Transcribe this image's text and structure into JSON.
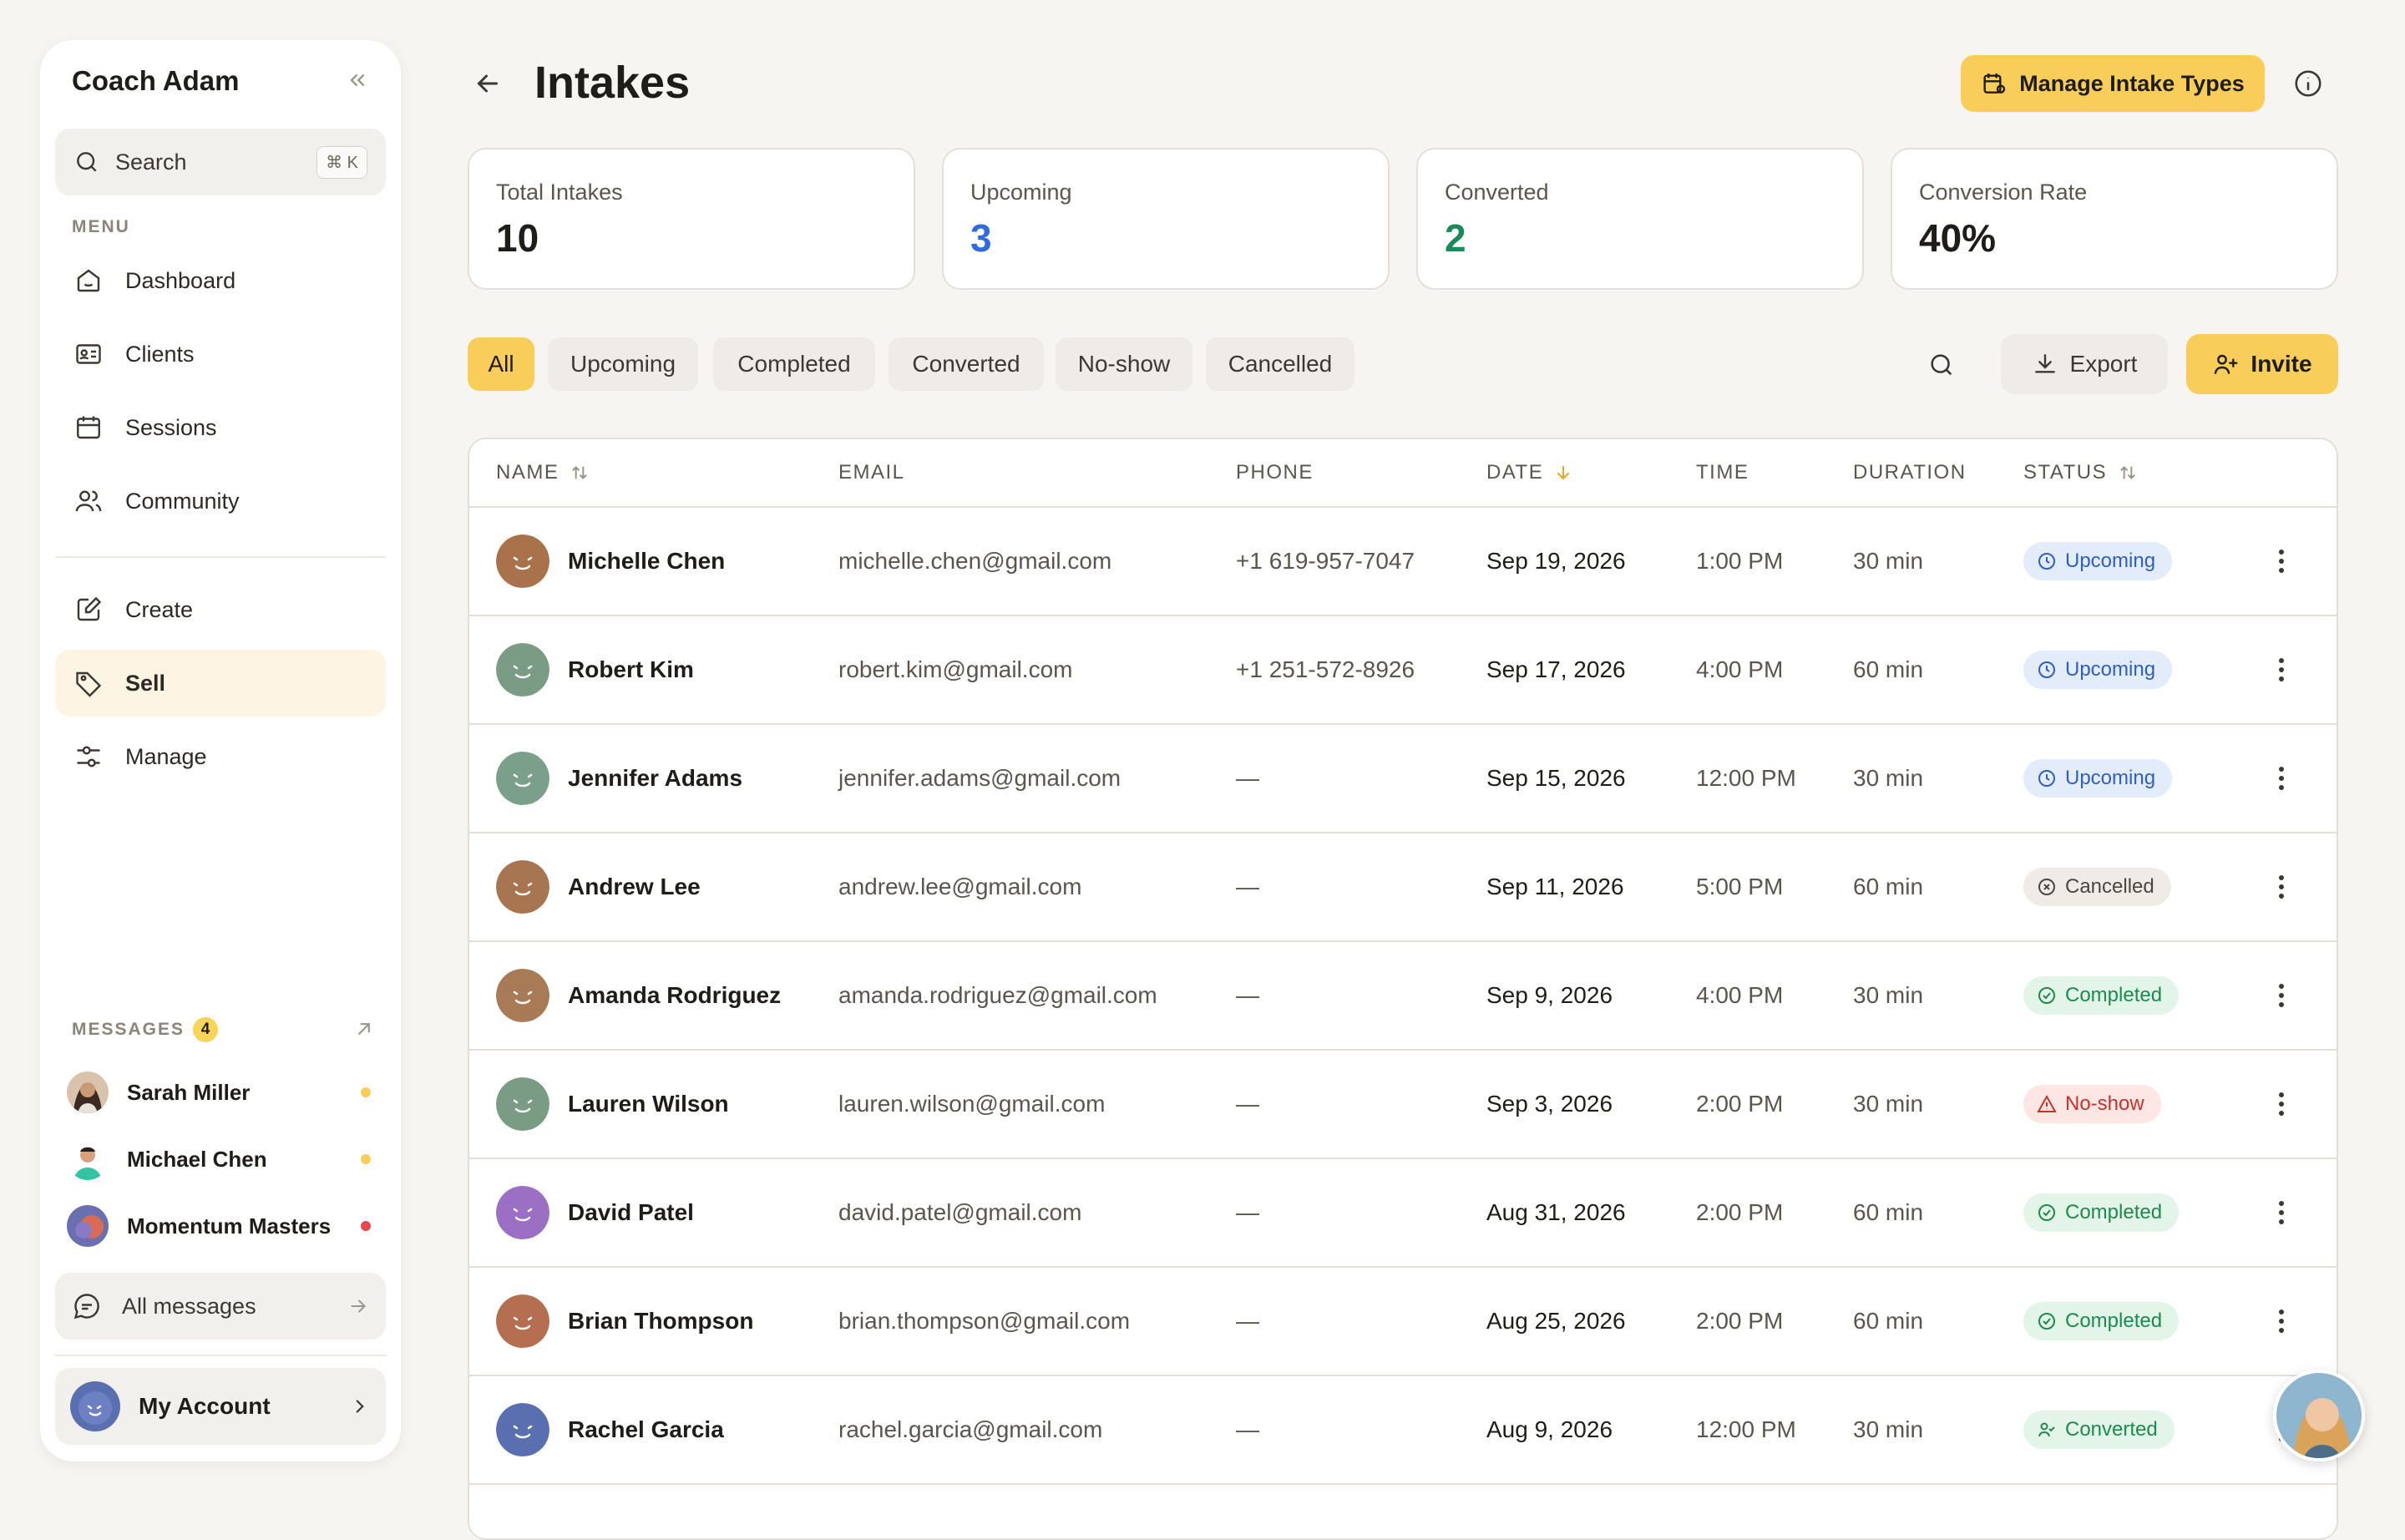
{
  "sidebar": {
    "title": "Coach Adam",
    "search": {
      "label": "Search",
      "shortcut": "⌘ K"
    },
    "menu_label": "MENU",
    "items": [
      {
        "label": "Dashboard",
        "icon": "home-icon"
      },
      {
        "label": "Clients",
        "icon": "id-card-icon"
      },
      {
        "label": "Sessions",
        "icon": "calendar-icon"
      },
      {
        "label": "Community",
        "icon": "users-icon"
      },
      {
        "label": "Create",
        "icon": "edit-icon"
      },
      {
        "label": "Sell",
        "icon": "tag-icon",
        "active": true
      },
      {
        "label": "Manage",
        "icon": "sliders-icon"
      }
    ],
    "messages_label": "MESSAGES",
    "messages_count": "4",
    "messages": [
      {
        "name": "Sarah Miller",
        "dot_color": "#f8cd5a"
      },
      {
        "name": "Michael Chen",
        "dot_color": "#f8cd5a"
      },
      {
        "name": "Momentum Masters",
        "dot_color": "#e5484d"
      }
    ],
    "all_messages": "All messages",
    "account": "My Account"
  },
  "header": {
    "title": "Intakes",
    "manage_button": "Manage Intake Types"
  },
  "stats": [
    {
      "label": "Total Intakes",
      "value": "10",
      "color": "#1f1d1a"
    },
    {
      "label": "Upcoming",
      "value": "3",
      "color": "#2f6bdb"
    },
    {
      "label": "Converted",
      "value": "2",
      "color": "#1b8a5a"
    },
    {
      "label": "Conversion Rate",
      "value": "40%",
      "color": "#1f1d1a"
    }
  ],
  "filters": [
    "All",
    "Upcoming",
    "Completed",
    "Converted",
    "No-show",
    "Cancelled"
  ],
  "active_filter": "All",
  "toolbar": {
    "export": "Export",
    "invite": "Invite"
  },
  "table": {
    "columns": [
      "NAME",
      "EMAIL",
      "PHONE",
      "DATE",
      "TIME",
      "DURATION",
      "STATUS"
    ],
    "rows": [
      {
        "name": "Michelle Chen",
        "email": "michelle.chen@gmail.com",
        "phone": "+1 619-957-7047",
        "date": "Sep 19, 2026",
        "time": "1:00 PM",
        "duration": "30 min",
        "status": "Upcoming",
        "avatar_color": "#a9724a"
      },
      {
        "name": "Robert Kim",
        "email": "robert.kim@gmail.com",
        "phone": "+1 251-572-8926",
        "date": "Sep 17, 2026",
        "time": "4:00 PM",
        "duration": "60 min",
        "status": "Upcoming",
        "avatar_color": "#7a9c84"
      },
      {
        "name": "Jennifer Adams",
        "email": "jennifer.adams@gmail.com",
        "phone": "—",
        "date": "Sep 15, 2026",
        "time": "12:00 PM",
        "duration": "30 min",
        "status": "Upcoming",
        "avatar_color": "#7aa08c"
      },
      {
        "name": "Andrew Lee",
        "email": "andrew.lee@gmail.com",
        "phone": "—",
        "date": "Sep 11, 2026",
        "time": "5:00 PM",
        "duration": "60 min",
        "status": "Cancelled",
        "avatar_color": "#a87551"
      },
      {
        "name": "Amanda Rodriguez",
        "email": "amanda.rodriguez@gmail.com",
        "phone": "—",
        "date": "Sep 9, 2026",
        "time": "4:00 PM",
        "duration": "30 min",
        "status": "Completed",
        "avatar_color": "#a97a56"
      },
      {
        "name": "Lauren Wilson",
        "email": "lauren.wilson@gmail.com",
        "phone": "—",
        "date": "Sep 3, 2026",
        "time": "2:00 PM",
        "duration": "30 min",
        "status": "No-show",
        "avatar_color": "#7a9c84"
      },
      {
        "name": "David Patel",
        "email": "david.patel@gmail.com",
        "phone": "—",
        "date": "Aug 31, 2026",
        "time": "2:00 PM",
        "duration": "60 min",
        "status": "Completed",
        "avatar_color": "#9b6fc4"
      },
      {
        "name": "Brian Thompson",
        "email": "brian.thompson@gmail.com",
        "phone": "—",
        "date": "Aug 25, 2026",
        "time": "2:00 PM",
        "duration": "60 min",
        "status": "Completed",
        "avatar_color": "#b56e4f"
      },
      {
        "name": "Rachel Garcia",
        "email": "rachel.garcia@gmail.com",
        "phone": "—",
        "date": "Aug 9, 2026",
        "time": "12:00 PM",
        "duration": "30 min",
        "status": "Converted",
        "avatar_color": "#5a6fb0"
      }
    ]
  },
  "status_styles": {
    "Upcoming": {
      "bg": "#e3ecfb",
      "fg": "#2f5fc2",
      "icon": "clock-icon"
    },
    "Cancelled": {
      "bg": "#efece7",
      "fg": "#4a4640",
      "icon": "x-circle-icon"
    },
    "Completed": {
      "bg": "#e3f5e8",
      "fg": "#1d8a4e",
      "icon": "check-circle-icon"
    },
    "No-show": {
      "bg": "#fde6e4",
      "fg": "#c8322b",
      "icon": "alert-triangle-icon"
    },
    "Converted": {
      "bg": "#e3f5e8",
      "fg": "#1d8a4e",
      "icon": "user-check-icon"
    }
  }
}
